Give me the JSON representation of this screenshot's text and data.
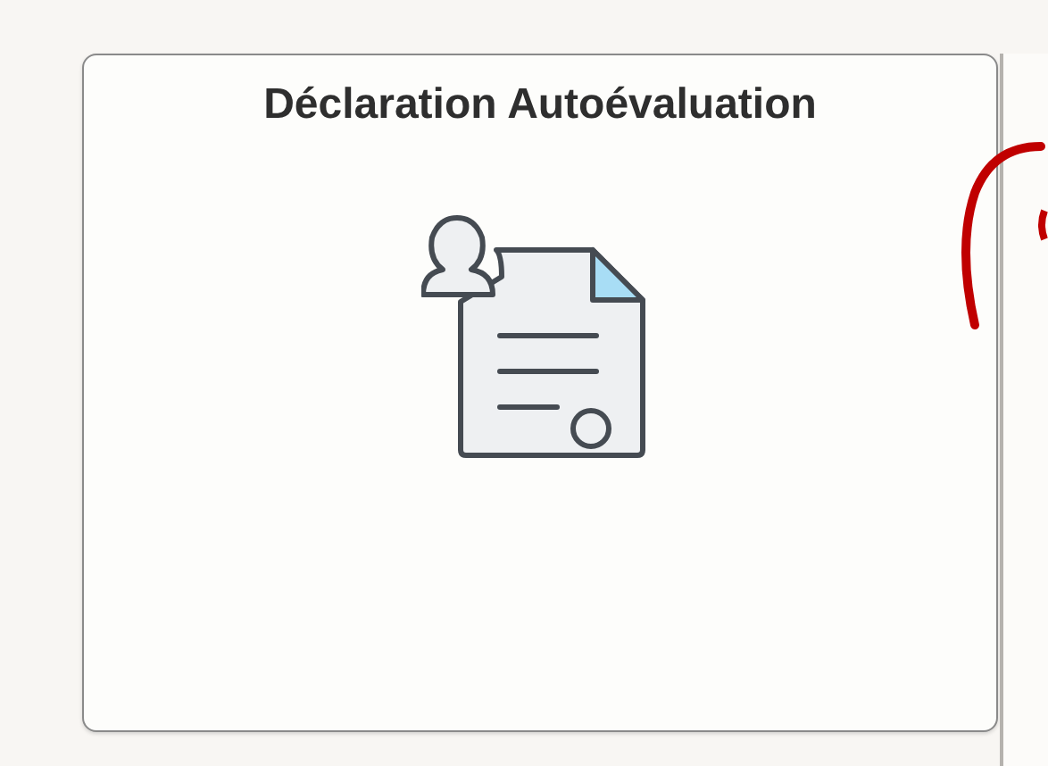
{
  "tile": {
    "title": "Déclaration Autoévaluation"
  }
}
